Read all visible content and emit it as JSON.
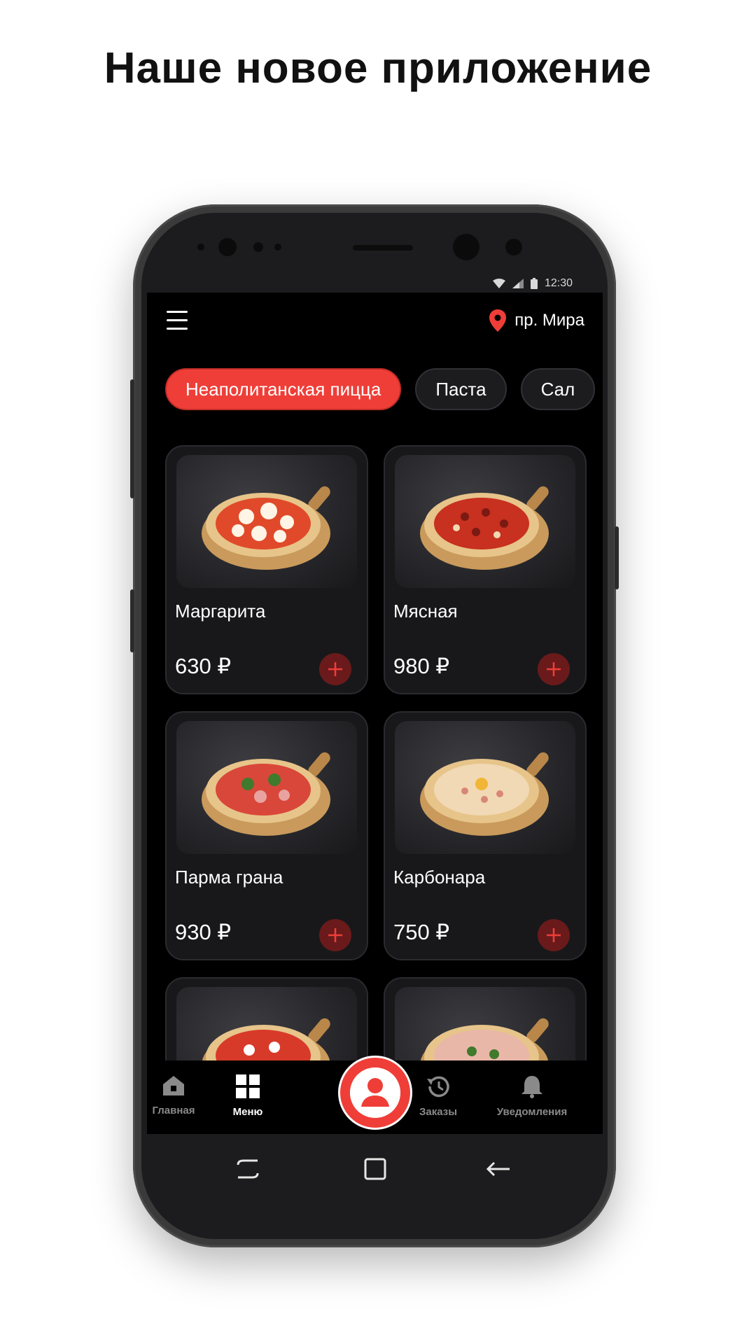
{
  "headline": "Наше новое приложение",
  "status_bar": {
    "time": "12:30"
  },
  "topbar": {
    "menu_icon": "hamburger-icon",
    "location_icon": "map-pin-icon",
    "location": "пр. Мира"
  },
  "categories": [
    {
      "label": "Неаполитанская пицца",
      "active": true
    },
    {
      "label": "Паста",
      "active": false
    },
    {
      "label": "Сал",
      "active": false
    }
  ],
  "products": [
    {
      "name": "Маргарита",
      "price": "630 ₽"
    },
    {
      "name": "Мясная",
      "price": "980 ₽"
    },
    {
      "name": "Парма грана",
      "price": "930 ₽"
    },
    {
      "name": "Карбонара",
      "price": "750 ₽"
    }
  ],
  "bottom_nav": {
    "items": [
      {
        "label": "Главная",
        "icon": "home-icon",
        "active": false
      },
      {
        "label": "Меню",
        "icon": "grid-icon",
        "active": true
      },
      {
        "label": "Заказы",
        "icon": "history-icon",
        "active": false
      },
      {
        "label": "Уведомления",
        "icon": "bell-icon",
        "active": false
      }
    ],
    "center_button_icon": "profile-icon"
  },
  "colors": {
    "accent": "#ef3e38",
    "background": "#000000",
    "card": "#18181b"
  }
}
